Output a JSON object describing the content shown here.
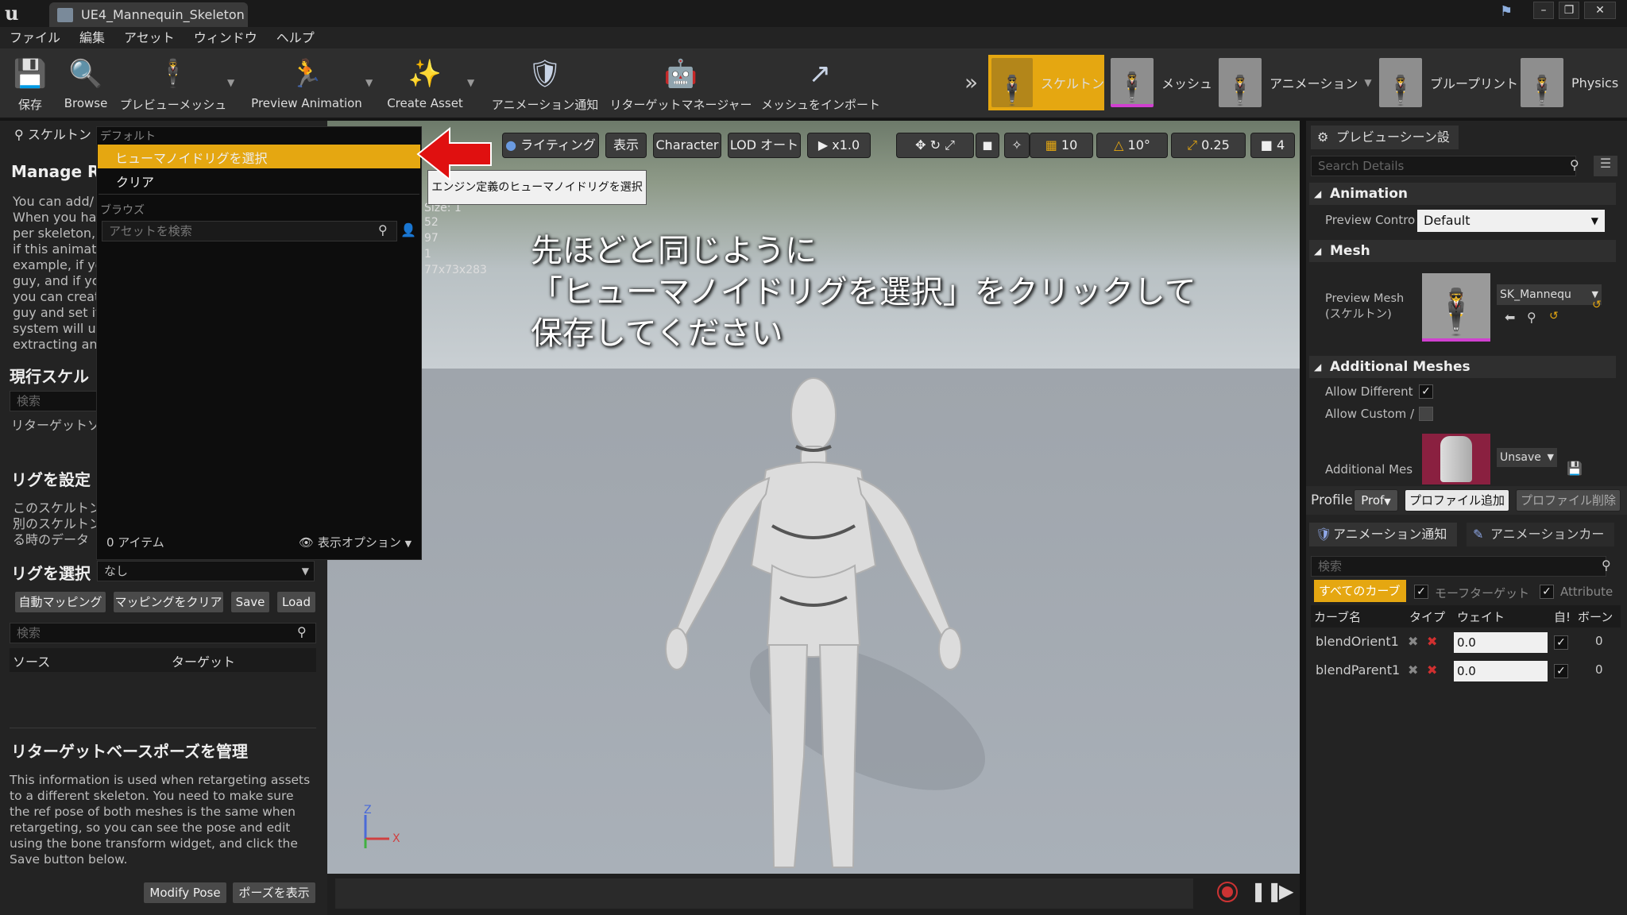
{
  "window": {
    "tab_title": "UE4_Mannequin_Skeleton"
  },
  "menubar": [
    "ファイル",
    "編集",
    "アセット",
    "ウィンドウ",
    "ヘルプ"
  ],
  "toolbar": {
    "save": "保存",
    "browse": "Browse",
    "preview_mesh": "プレビューメッシュ",
    "preview_animation": "Preview Animation",
    "create_asset": "Create Asset",
    "anim_notify": "アニメーション通知",
    "retarget_manager": "リターゲットマネージャー",
    "import_mesh": "メッシュをインポート"
  },
  "modes": {
    "skeleton": "スケルトン",
    "mesh": "メッシュ",
    "animation": "アニメーション",
    "blueprint": "ブループリント",
    "physics": "Physics"
  },
  "left": {
    "tab": "スケルトン",
    "manage_title": "Manage Ret",
    "manage_text": "You can add/\nWhen you hav\nper skeleton,\nif this animati\nexample, if yo\nguy, and if yo\nyou can creat\nguy and set it\nsystem will u\nextracting ani",
    "current_skel": "現行スケル",
    "search_ph": "検索",
    "retarget_source": "リターゲットソー",
    "set_rig": "リグを設定",
    "rig_text": "このスケルトン\n別のスケルトン\nる時のデータ",
    "select_rig": "リグを選択",
    "select_rig_value": "なし",
    "auto_map": "自動マッピング",
    "clear_map": "マッピングをクリア",
    "save": "Save",
    "load": "Load",
    "col_source": "ソース",
    "col_target": "ターゲット",
    "base_pose_title": "リターゲットベースポーズを管理",
    "base_pose_text": "This information is used when retargeting assets\nto a different skeleton. You need to make sure\nthe ref pose of both meshes is the same when\nretargeting, so you can see the pose and edit\nusing the bone transform widget, and click the\nSave button below.",
    "modify_pose": "Modify Pose",
    "show_pose": "ポーズを表示"
  },
  "dropdown": {
    "default_hdr": "デフォルト",
    "select_humanoid": "ヒューマノイドリグを選択",
    "clear": "クリア",
    "browse_hdr": "ブラウズ",
    "search_ph": "アセットを検索",
    "item_count": "0 アイテム",
    "view_options": "表示オプション"
  },
  "tooltip": "エンジン定義のヒューマノイドリグを選択",
  "viewport": {
    "lighting": "ライティング",
    "show": "表示",
    "character": "Character",
    "lod": "LOD オート",
    "speed": "x1.0",
    "grid": "10",
    "angle": "10°",
    "scale": "0.25",
    "cam": "4",
    "stats": [
      "Size: 1",
      "52",
      "97",
      "1",
      "77x73x283"
    ],
    "overlay": [
      "先ほどと同じように",
      "「ヒューマノイドリグを選択」をクリックして",
      "保存してください"
    ],
    "axis_z": "Z",
    "axis_x": "X"
  },
  "right": {
    "tab": "プレビューシーン設",
    "search_ph": "Search Details",
    "animation": "Animation",
    "preview_controller": "Preview Contro",
    "preview_controller_value": "Default",
    "mesh": "Mesh",
    "preview_mesh": "Preview Mesh\n(スケルトン)",
    "mesh_value": "SK_Mannequ",
    "additional_meshes": "Additional Meshes",
    "allow_different": "Allow Different",
    "allow_custom": "Allow Custom /",
    "additional_mesh": "Additional Mes",
    "unsaved": "Unsave",
    "profile": "Profile",
    "prof": "Prof",
    "add_profile": "プロファイル追加",
    "del_profile": "プロファイル削除",
    "tab_notify": "アニメーション通知",
    "tab_curves": "アニメーションカー",
    "curve_search": "検索",
    "all_curves": "すべてのカーブ",
    "morph_target": "モーフターゲット",
    "attribute": "Attribute",
    "col_name": "カーブ名",
    "col_type": "タイプ",
    "col_weight": "ウェイト",
    "col_auto": "自!",
    "col_bone": "ボーン",
    "curves": [
      {
        "name": "blendOrient1",
        "weight": "0.0",
        "bone": "0"
      },
      {
        "name": "blendParent1",
        "weight": "0.0",
        "bone": "0"
      }
    ]
  },
  "colors": {
    "accent": "#e5a711",
    "arrow": "#e01010"
  }
}
